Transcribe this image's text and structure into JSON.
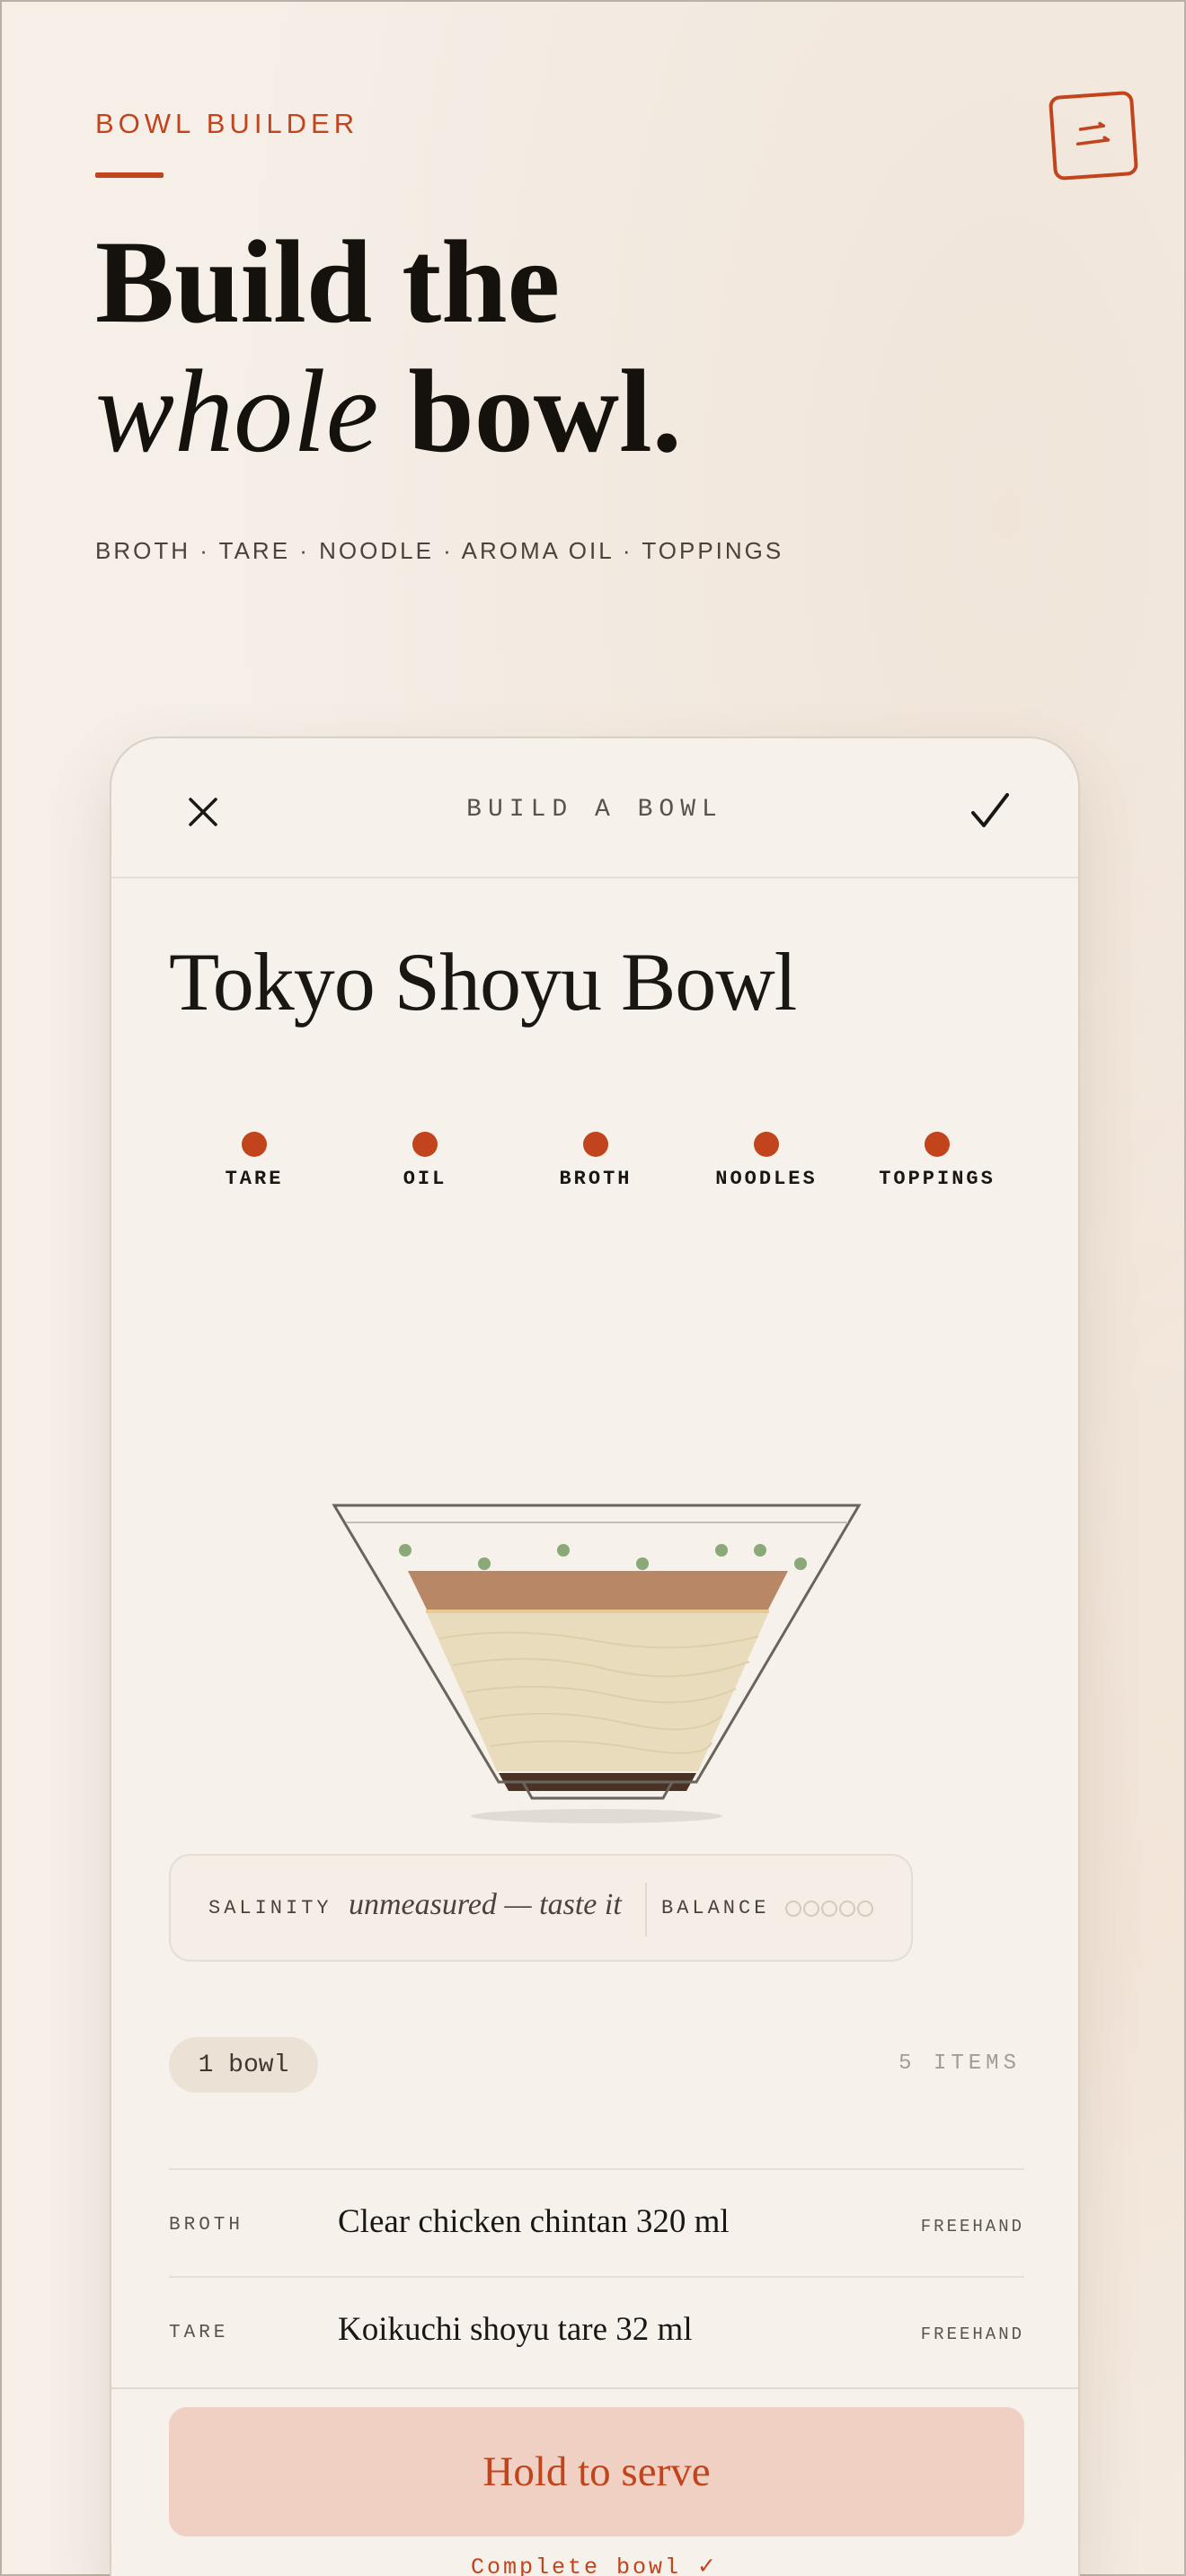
{
  "hero": {
    "eyebrow": "BOWL BUILDER",
    "headline_line1": "Build the",
    "headline_italic": "whole",
    "headline_rest": " bowl.",
    "subtags": "BROTH · TARE · NOODLE · AROMA OIL · TOPPINGS",
    "menu_icon": "two-line-menu-icon"
  },
  "card": {
    "header_title": "BUILD A BOWL",
    "close_icon": "close-icon",
    "confirm_icon": "checkmark-icon",
    "bowl_name": "Tokyo Shoyu Bowl",
    "steps": [
      {
        "label": "TARE",
        "done": true
      },
      {
        "label": "OIL",
        "done": true
      },
      {
        "label": "BROTH",
        "done": true
      },
      {
        "label": "NOODLES",
        "done": true
      },
      {
        "label": "TOPPINGS",
        "done": true
      }
    ],
    "metrics": {
      "salinity_label": "SALINITY",
      "salinity_value": "unmeasured — taste it",
      "balance_label": "BALANCE",
      "balance_filled": 0,
      "balance_total": 5
    },
    "quantity": "1 bowl",
    "items_count": "5 ITEMS",
    "ingredients": [
      {
        "category": "BROTH",
        "name": "Clear chicken chintan 320 ml",
        "mode": "FREEHAND"
      },
      {
        "category": "TARE",
        "name": "Koikuchi shoyu tare 32 ml",
        "mode": "FREEHAND"
      }
    ],
    "serve_button": "Hold to serve",
    "complete_link": "Complete bowl ✓"
  },
  "colors": {
    "accent": "#c1441d",
    "background": "#f5efe8",
    "serve_button_bg": "#efd0c3",
    "topping_green": "#8aa878",
    "oil_layer": "#b88766",
    "noodle_layer": "#e8dcbc",
    "tare_layer": "#4a3224"
  }
}
